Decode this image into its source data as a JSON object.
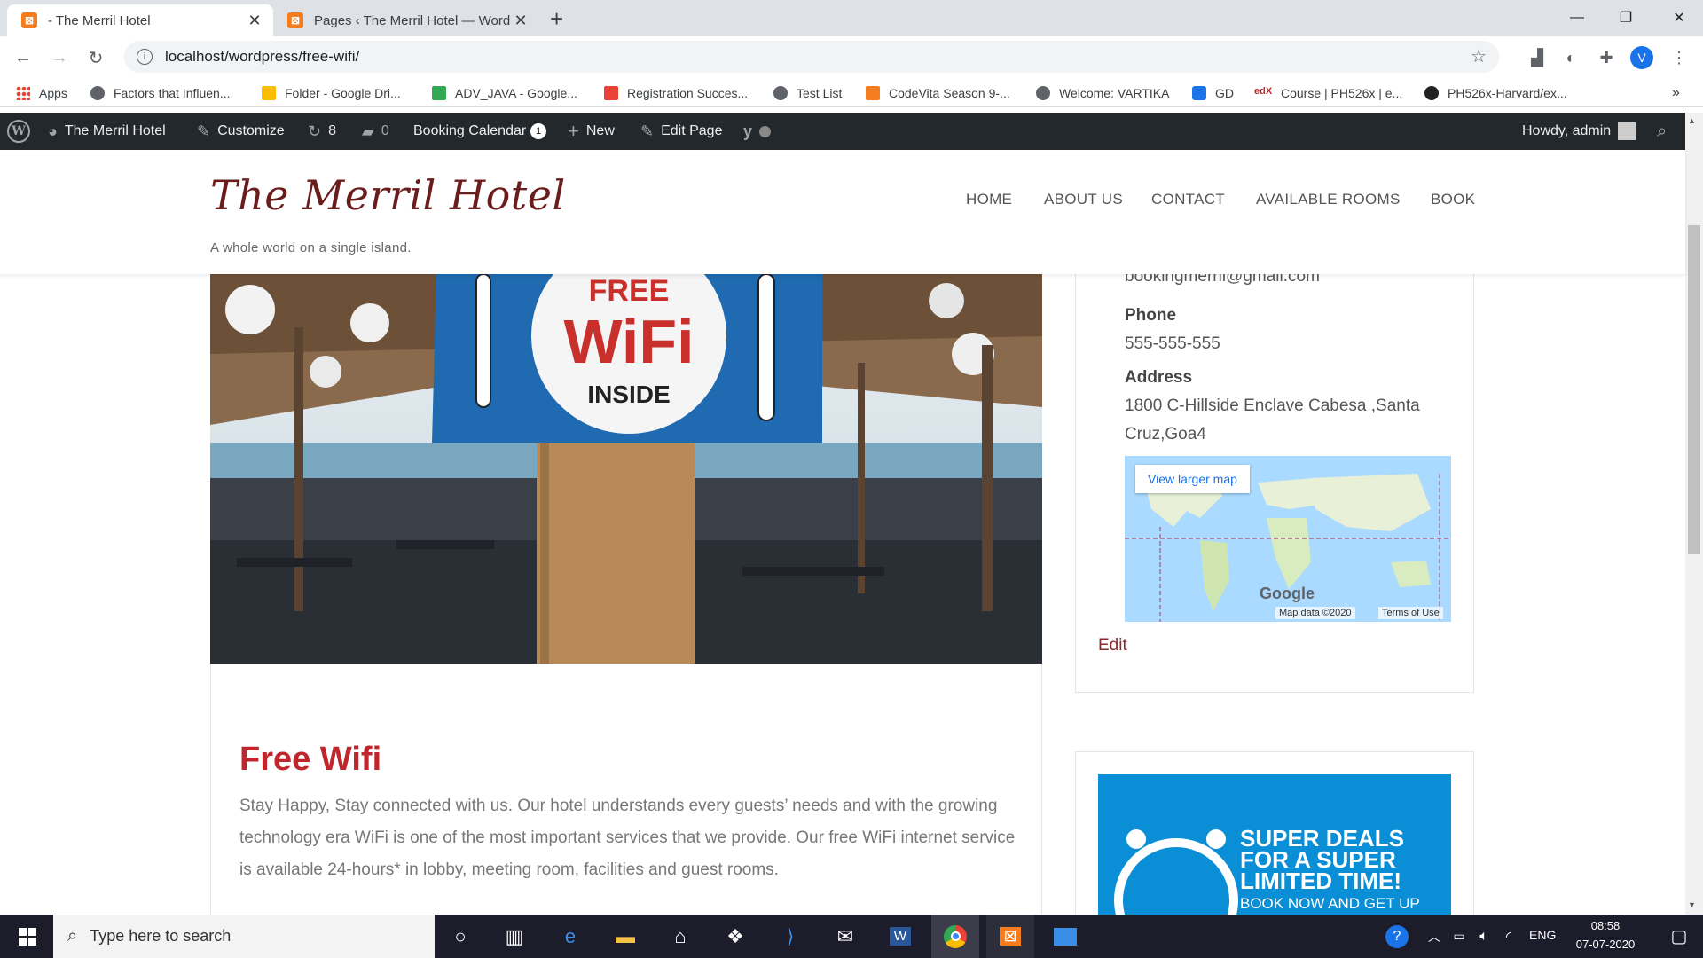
{
  "browser": {
    "tabs": [
      {
        "title": "- The Merril Hotel",
        "active": true
      },
      {
        "title": "Pages ‹ The Merril Hotel — Word",
        "active": false
      }
    ],
    "new_tab": "+",
    "url": "localhost/wordpress/free-wifi/",
    "profile_initial": "V",
    "bookmarks": [
      "Apps",
      "Factors that Influen...",
      "Folder - Google Dri...",
      "ADV_JAVA - Google...",
      "Registration Succes...",
      "Test List",
      "CodeVita Season 9-...",
      "Welcome: VARTIKA",
      "GD",
      "Course | PH526x | e...",
      "PH526x-Harvard/ex..."
    ],
    "more_bookmarks": "»"
  },
  "adminbar": {
    "site_name": "The Merril Hotel",
    "customize": "Customize",
    "updates": "8",
    "comments": "0",
    "booking_calendar": "Booking Calendar",
    "booking_badge": "1",
    "new": "New",
    "edit_page": "Edit Page",
    "howdy": "Howdy, admin"
  },
  "site": {
    "title": "The Merril Hotel",
    "tagline": "A whole world on a single island.",
    "menu": [
      "HOME",
      "ABOUT US",
      "CONTACT",
      "AVAILABLE ROOMS",
      "BOOK"
    ]
  },
  "hero_sign": {
    "line1": "FREE",
    "line2": "WiFi",
    "line3": "INSIDE"
  },
  "post": {
    "title": "Free Wifi",
    "body": "Stay Happy, Stay connected with us. Our hotel understands every guests’ needs and with the growing technology era WiFi is one of the most important services that we provide. Our free WiFi internet service is available 24-hours* in lobby, meeting room, facilities and guest rooms."
  },
  "sidebar": {
    "email": "bookingmerril@gmail.com",
    "phone_label": "Phone",
    "phone": "555-555-555",
    "address_label": "Address",
    "address_line1": "1800 C-Hillside Enclave Cabesa ,Santa",
    "address_line2": "Cruz,Goa4",
    "map_link": "View larger map",
    "map_brand": "Google",
    "map_data": "Map data ©2020",
    "map_terms": "Terms of Use",
    "edit": "Edit",
    "promo_line1": "SUPER DEALS",
    "promo_line2": "FOR A SUPER",
    "promo_line3": "LIMITED TIME!",
    "promo_line4": "BOOK NOW AND GET UP"
  },
  "taskbar": {
    "search_placeholder": "Type here to search",
    "language": "ENG",
    "time": "08:58",
    "date": "07-07-2020"
  },
  "colors": {
    "accent": "#c0272d",
    "site_title": "#6b1d1d",
    "adminbar": "#23282d",
    "promo": "#0a8fd6"
  }
}
